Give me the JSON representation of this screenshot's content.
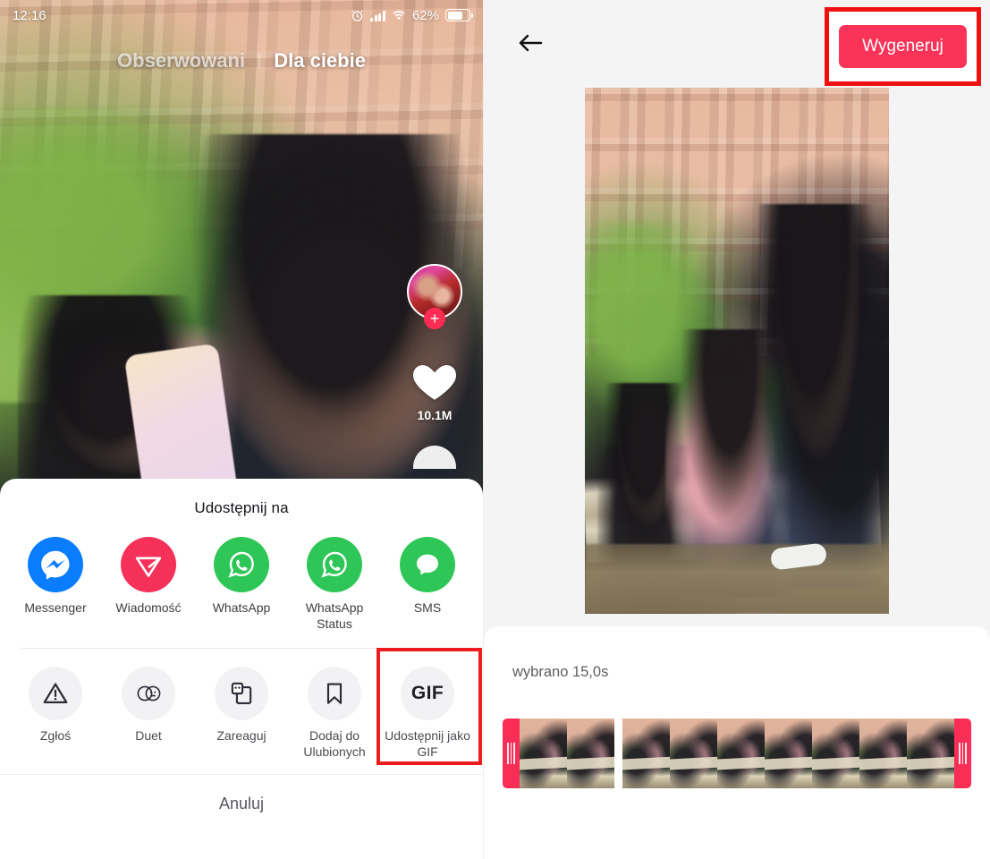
{
  "left": {
    "status_bar": {
      "time": "12:16",
      "alarm_icon": "alarm-icon",
      "signal_icon": "signal-icon",
      "wifi_icon": "wifi-icon",
      "battery_percent": "62%",
      "battery_icon": "battery-icon"
    },
    "tabs": {
      "following": "Obserwowani",
      "separator": "|",
      "for_you": "Dla ciebie"
    },
    "rail": {
      "avatar_name": "avatar",
      "follow_icon": "plus-icon",
      "like_icon": "heart-icon",
      "like_count": "10.1M"
    },
    "share_sheet": {
      "title": "Udostępnij na",
      "apps": [
        {
          "label": "Messenger",
          "icon": "messenger-icon",
          "color": "#0a7cff"
        },
        {
          "label": "Wiadomość",
          "icon": "direct-message-icon",
          "color": "#f5315a"
        },
        {
          "label": "WhatsApp",
          "icon": "whatsapp-icon",
          "color": "#2ec657"
        },
        {
          "label": "WhatsApp Status",
          "icon": "whatsapp-status-icon",
          "color": "#2ec657"
        },
        {
          "label": "SMS",
          "icon": "sms-icon",
          "color": "#2ec657"
        }
      ],
      "actions": [
        {
          "label": "Zgłoś",
          "icon": "warning-triangle-icon",
          "highlighted": false
        },
        {
          "label": "Duet",
          "icon": "duet-icon",
          "highlighted": false
        },
        {
          "label": "Zareaguj",
          "icon": "react-icon",
          "highlighted": false
        },
        {
          "label": "Dodaj do Ulubionych",
          "icon": "bookmark-icon",
          "highlighted": false
        },
        {
          "label": "Udostępnij jako GIF",
          "icon": "gif-icon",
          "icon_text": "GIF",
          "highlighted": true
        }
      ],
      "cancel": "Anuluj"
    }
  },
  "right": {
    "header": {
      "back_icon": "back-arrow-icon",
      "generate_button": "Wygeneruj"
    },
    "preview": {
      "name": "video-preview"
    },
    "timeline": {
      "selection_label": "wybrano 15,0s",
      "left_handle": "trim-handle-left",
      "right_handle": "trim-handle-right"
    }
  },
  "colors": {
    "accent_pink": "#fa3359",
    "highlight_red": "#ee1111",
    "panel_bg": "#f4f4f4",
    "sheet_bg": "#ffffff"
  }
}
